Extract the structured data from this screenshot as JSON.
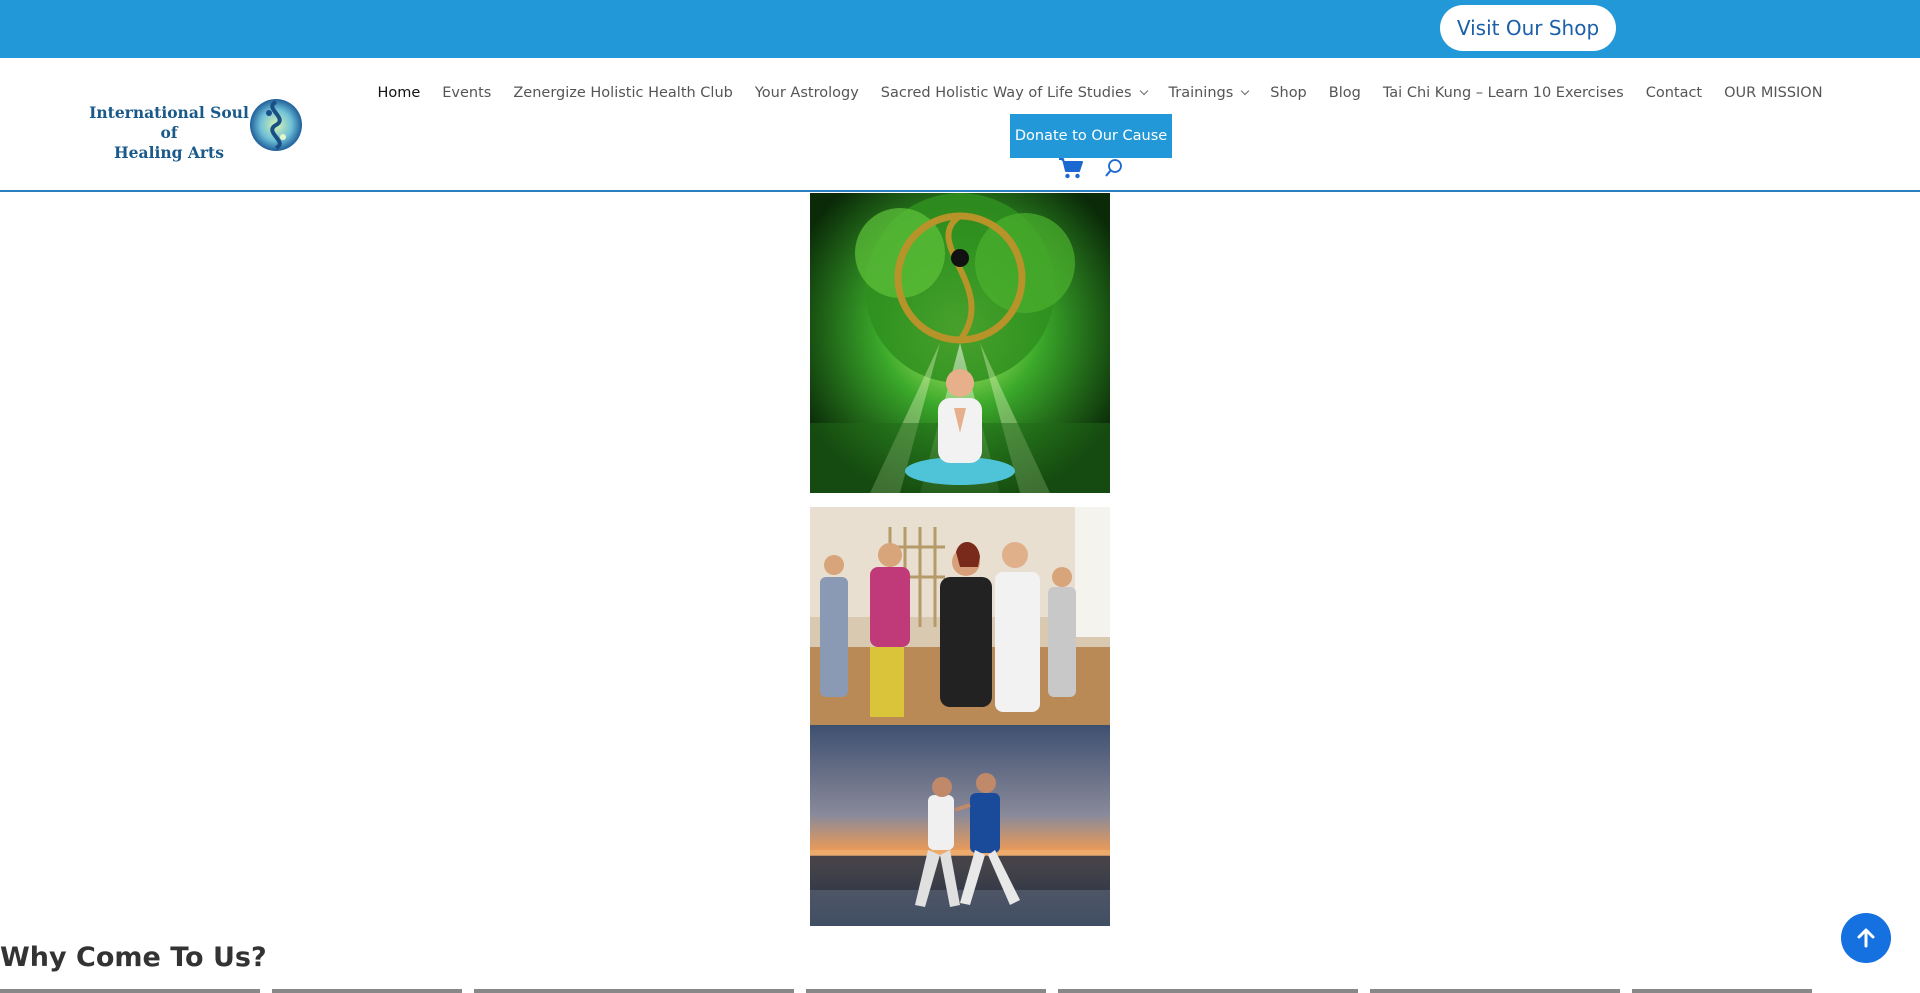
{
  "topbar": {
    "shop_button": "Visit Our Shop",
    "bg_color": "#2398d8"
  },
  "header": {
    "logo_line1": "International Soul of",
    "logo_line2": "Healing Arts",
    "nav": [
      {
        "label": "Home",
        "active": true
      },
      {
        "label": "Events"
      },
      {
        "label": "Zenergize Holistic Health Club"
      },
      {
        "label": "Your Astrology"
      },
      {
        "label": "Sacred Holistic Way of Life Studies",
        "dropdown": true
      },
      {
        "label": "Trainings",
        "dropdown": true
      },
      {
        "label": "Shop"
      },
      {
        "label": "Blog"
      },
      {
        "label": "Tai Chi Kung – Learn 10 Exercises"
      },
      {
        "label": "Contact"
      },
      {
        "label": "OUR MISSION"
      }
    ],
    "donate_label": "Donate to Our Cause",
    "icons": [
      "cart-icon",
      "search-icon"
    ]
  },
  "main": {
    "heading": "Why Come To Us?"
  },
  "colors": {
    "accent": "#2398d8",
    "scroll_top": "#1570e0"
  }
}
